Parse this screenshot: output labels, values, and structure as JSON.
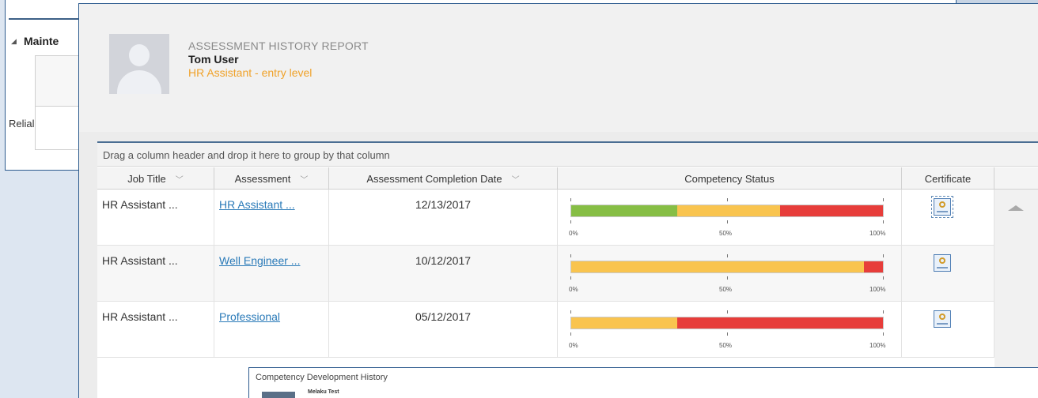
{
  "background_window": {
    "section_heading": "Mainte",
    "cell_text": "Relial"
  },
  "report": {
    "title": "ASSESSMENT HISTORY REPORT",
    "user_name": "Tom User",
    "user_role": "HR Assistant - entry level"
  },
  "grid": {
    "group_hint": "Drag a column header and drop it here to group by that column",
    "columns": [
      "Job Title",
      "Assessment",
      "Assessment Completion Date",
      "Competency Status",
      "Certificate"
    ],
    "scale_labels": [
      "0%",
      "50%",
      "100%"
    ],
    "rows": [
      {
        "job_title": "HR Assistant ...",
        "assessment": "HR Assistant ...",
        "date": "12/13/2017",
        "status": {
          "green": 0.34,
          "yellow": 0.33,
          "red": 0.33
        }
      },
      {
        "job_title": "HR Assistant ...",
        "assessment": "Well Engineer ...",
        "date": "10/12/2017",
        "status": {
          "green": 0,
          "yellow": 0.94,
          "red": 0.06
        }
      },
      {
        "job_title": "HR Assistant ...",
        "assessment": "Professional",
        "date": "05/12/2017",
        "status": {
          "green": 0,
          "yellow": 0.34,
          "red": 0.66
        }
      }
    ]
  },
  "popup": {
    "title": "Competency Development History",
    "name": "Melaku Test"
  },
  "colors": {
    "green": "#86be45",
    "yellow": "#f9c44f",
    "red": "#e73d3a",
    "link": "#2a7ab8",
    "role": "#f0a22a"
  }
}
